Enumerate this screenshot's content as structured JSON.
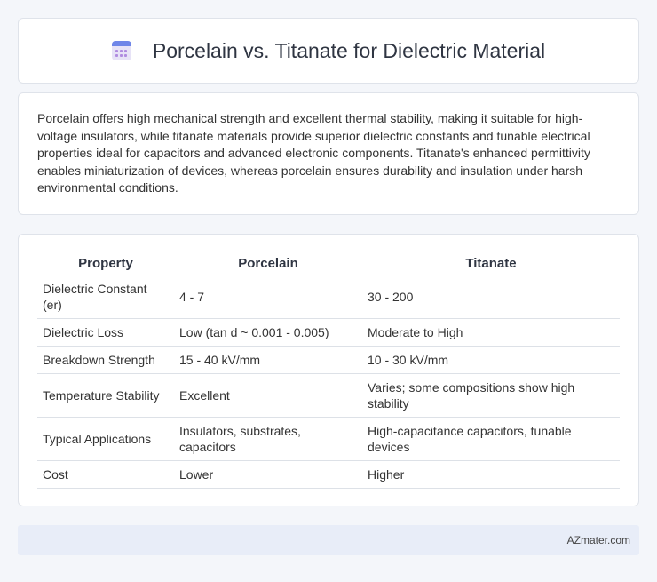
{
  "header": {
    "title": "Porcelain vs. Titanate for Dielectric Material",
    "icon": "calendar-icon"
  },
  "description": "Porcelain offers high mechanical strength and excellent thermal stability, making it suitable for high-voltage insulators, while titanate materials provide superior dielectric constants and tunable electrical properties ideal for capacitors and advanced electronic components. Titanate's enhanced permittivity enables miniaturization of devices, whereas porcelain ensures durability and insulation under harsh environmental conditions.",
  "table": {
    "headers": [
      "Property",
      "Porcelain",
      "Titanate"
    ],
    "rows": [
      [
        "Dielectric Constant (er)",
        "4 - 7",
        "30 - 200"
      ],
      [
        "Dielectric Loss",
        "Low (tan d ~ 0.001 - 0.005)",
        "Moderate to High"
      ],
      [
        "Breakdown Strength",
        "15 - 40 kV/mm",
        "10 - 30 kV/mm"
      ],
      [
        "Temperature Stability",
        "Excellent",
        "Varies; some compositions show high stability"
      ],
      [
        "Typical Applications",
        "Insulators, substrates, capacitors",
        "High-capacitance capacitors, tunable devices"
      ],
      [
        "Cost",
        "Lower",
        "Higher"
      ]
    ]
  },
  "footer": {
    "site": "AZmater.com"
  }
}
